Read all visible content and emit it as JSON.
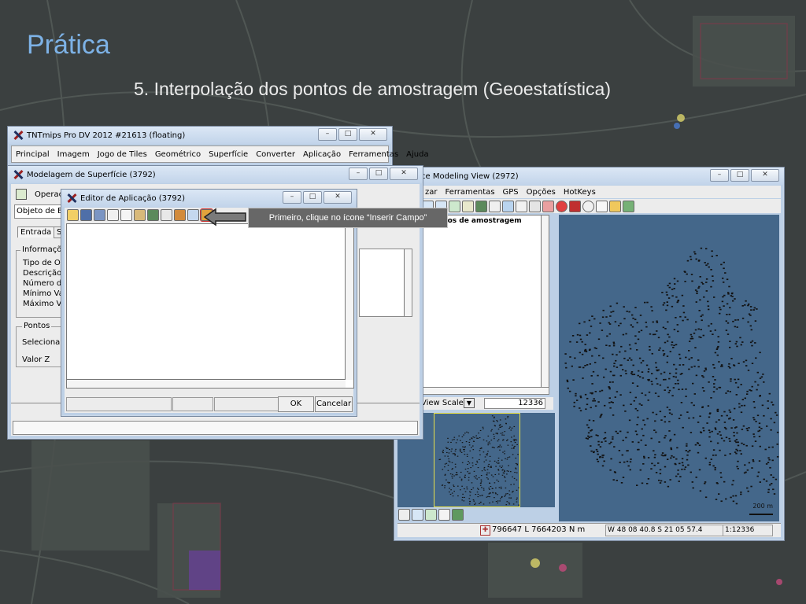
{
  "slide": {
    "title": "Prática",
    "subtitle": "5. Interpolação dos pontos de amostragem (Geoestatística)"
  },
  "main_window": {
    "title": "TNTmips Pro DV 2012  #21613 (floating)",
    "menu": [
      "Principal",
      "Imagem",
      "Jogo de Tiles",
      "Geométrico",
      "Superfície",
      "Converter",
      "Aplicação",
      "Ferramentas",
      "Ajuda"
    ]
  },
  "surface_window": {
    "title": "Modelagem de Superfície (3792)",
    "operation_label": "Operaçõ",
    "object_label": "Objeto de Ent",
    "tabs": [
      "Entrada",
      "S"
    ],
    "info_group": "Informaçõ",
    "info_rows": [
      "Tipo de Obj",
      "Descrição:",
      "Número de",
      "Mínimo Valo",
      "Máximo Valo"
    ],
    "points_group": "Pontos",
    "select_label": "Selecionar",
    "z_value_label": "Valor Z"
  },
  "app_editor": {
    "title": "Editor de Aplicação (3792)",
    "ok_label": "OK",
    "cancel_label": "Cancelar"
  },
  "view_window": {
    "title": "ce Modeling View (2972)",
    "menu": [
      "zar",
      "Ferramentas",
      "GPS",
      "Opções",
      "HotKeys"
    ],
    "layer_label": "e pontos de amostragem",
    "scale_label": "View Scale",
    "scale_value": "12336",
    "coord_text": "796647 L  7664203 N m",
    "latlon_text": "W 48 08 40.8   S 21 05 57.4",
    "ratio_text": "1:12336",
    "scalebar_label": "200 m"
  },
  "callout": {
    "text": "Primeiro, clique no ícone “Inserir Campo”"
  },
  "colors": {
    "title_blue": "#7db2e6",
    "map_blue": "#44678a",
    "callout_gray": "#676767"
  }
}
